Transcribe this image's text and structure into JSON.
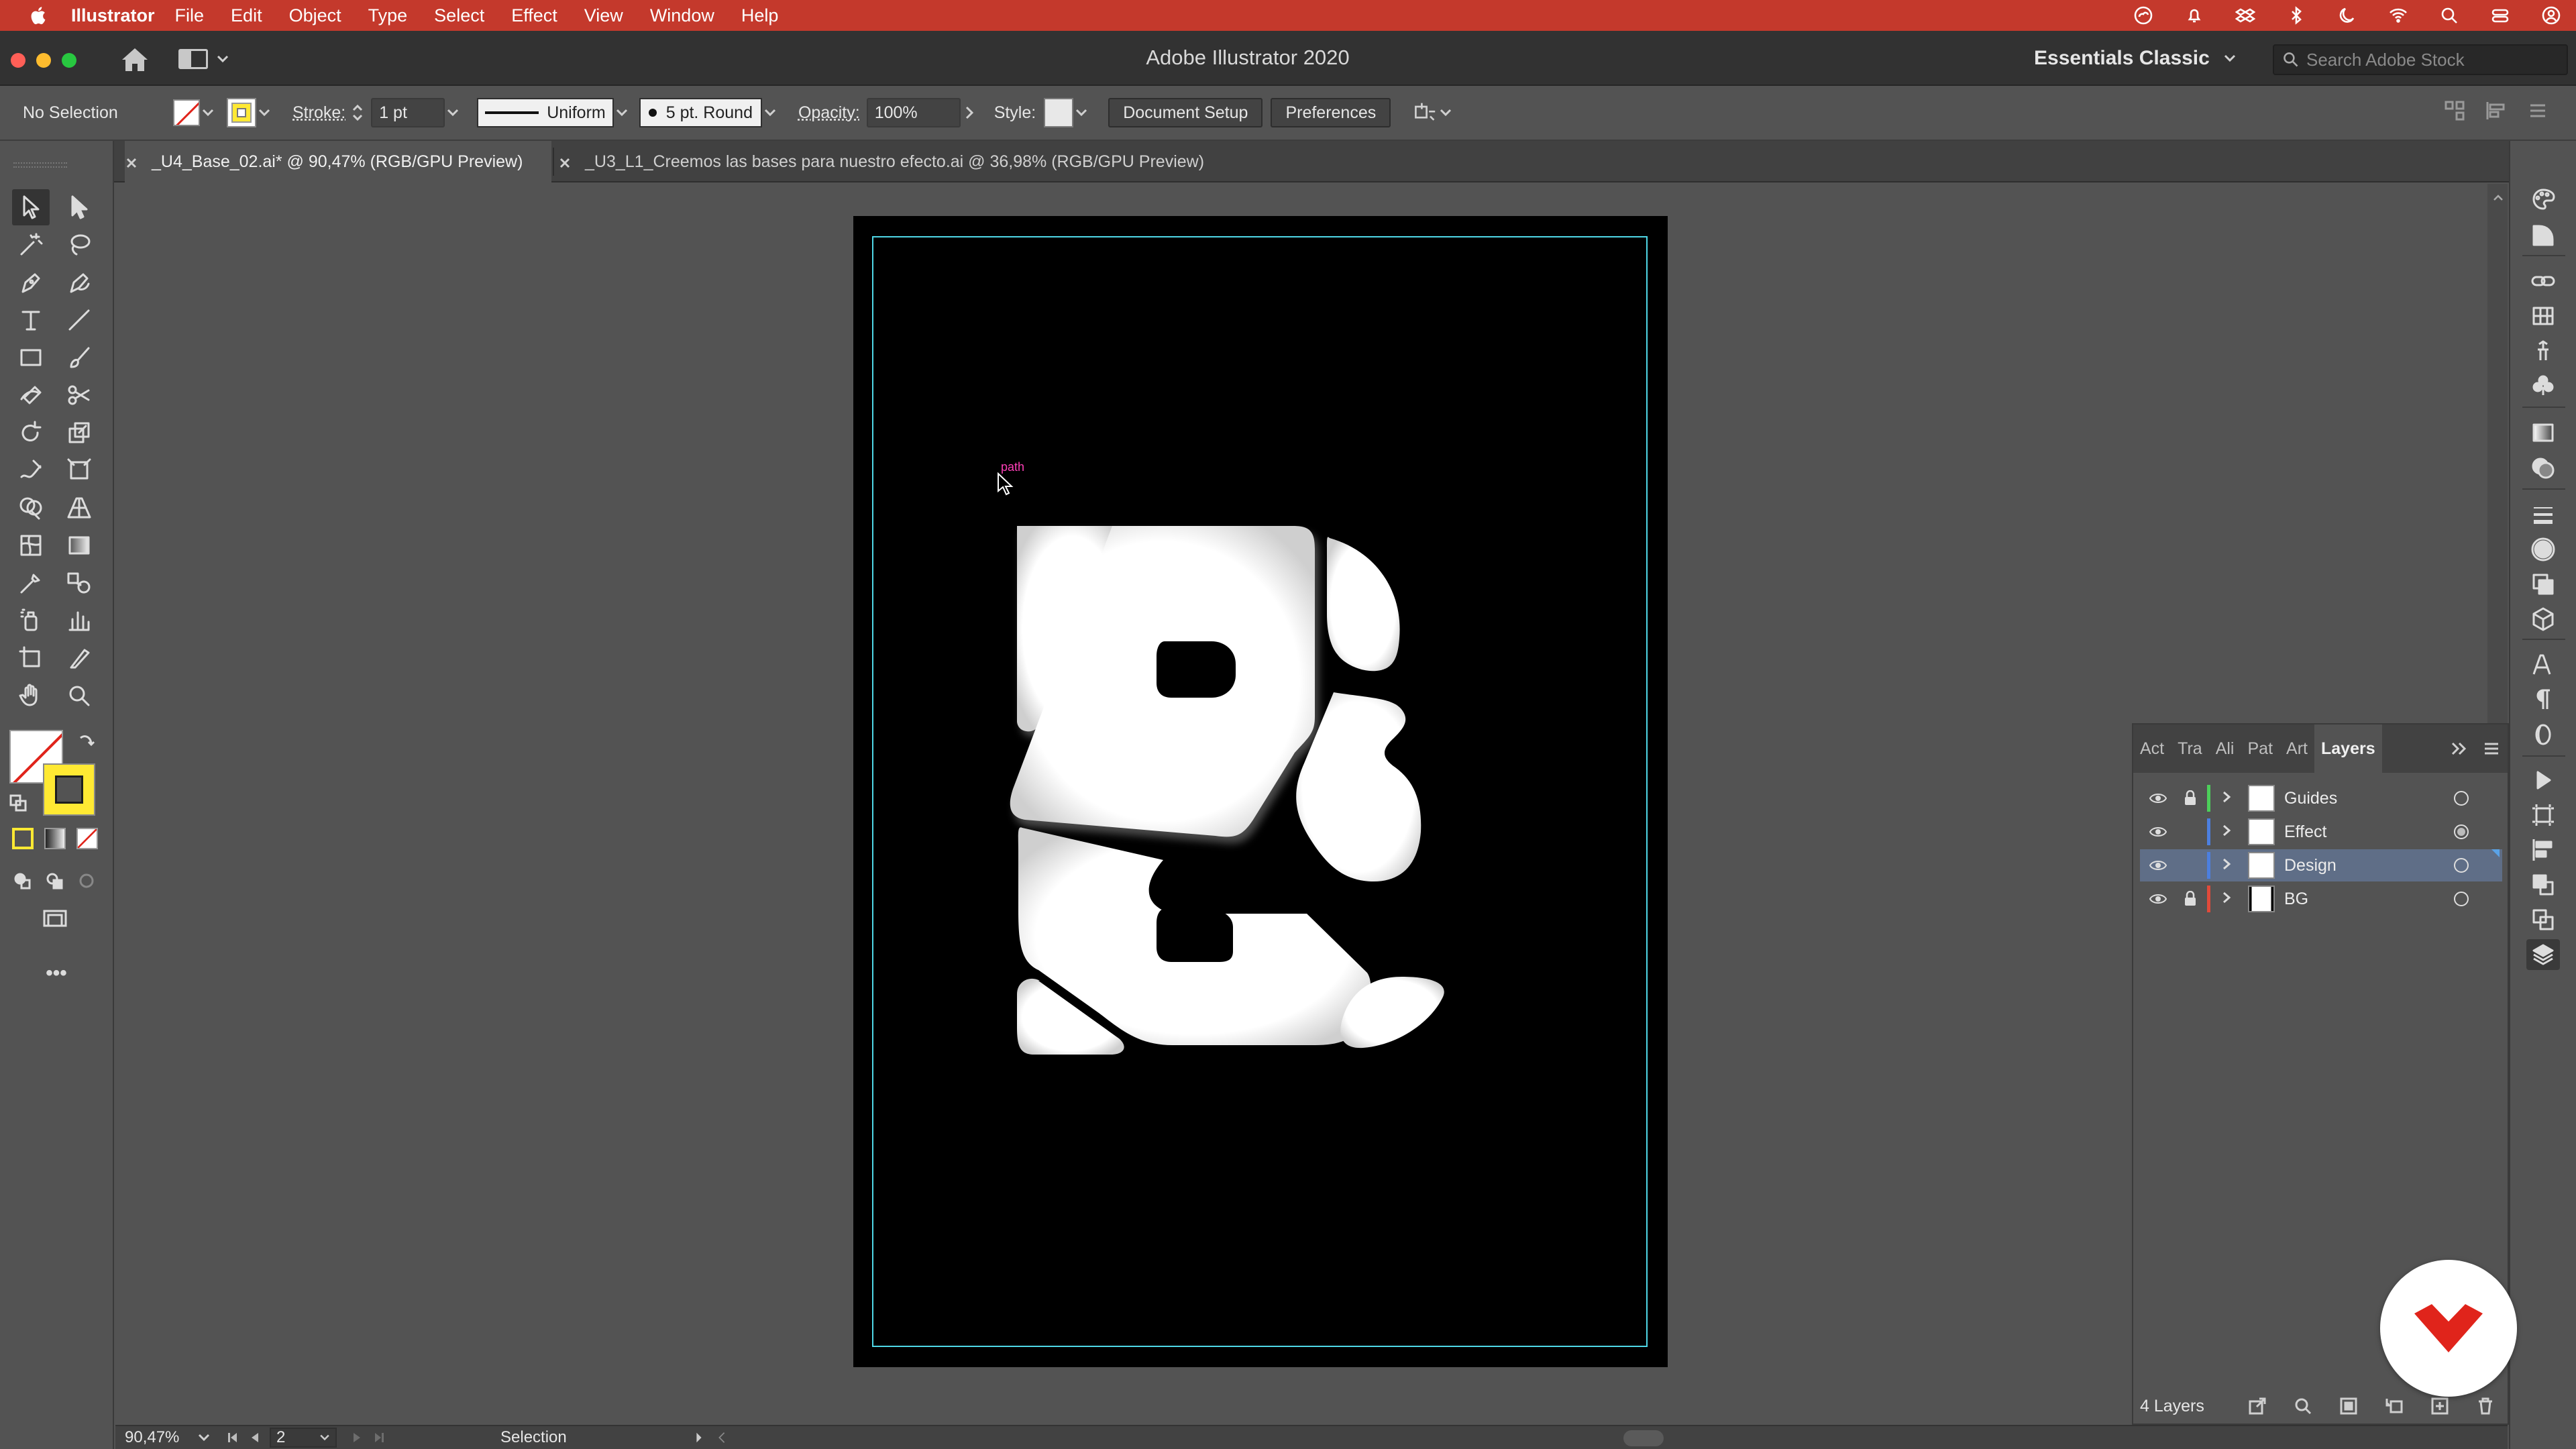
{
  "menubar": {
    "app_name": "Illustrator",
    "items": [
      "File",
      "Edit",
      "Object",
      "Type",
      "Select",
      "Effect",
      "View",
      "Window",
      "Help"
    ],
    "status_icons": [
      "creative-cloud-icon",
      "notification-icon",
      "dropbox-icon",
      "bluetooth-icon",
      "moon-icon",
      "wifi-icon",
      "search-icon",
      "control-center-icon",
      "user-icon"
    ],
    "color": "#c4392c"
  },
  "titlebar": {
    "title": "Adobe Illustrator 2020",
    "workspace": "Essentials Classic",
    "search_placeholder": "Search Adobe Stock"
  },
  "controlbar": {
    "selection_label": "No Selection",
    "stroke_label": "Stroke:",
    "stroke_weight": "1 pt",
    "variable_width_profile": "Uniform",
    "brush": "5 pt. Round",
    "opacity_label": "Opacity:",
    "opacity_value": "100%",
    "style_label": "Style:",
    "document_setup": "Document Setup",
    "preferences": "Preferences",
    "fill_color": "none",
    "stroke_color": "#ffe933"
  },
  "tabs": [
    {
      "label": "_U4_Base_02.ai* @ 90,47% (RGB/GPU Preview)",
      "active": true
    },
    {
      "label": "_U3_L1_Creemos las bases para nuestro efecto.ai @ 36,98% (RGB/GPU Preview)",
      "active": false
    }
  ],
  "canvas": {
    "smart_guide_label": "path",
    "artboard_color": "#000000",
    "guide_color": "#4fd7e6"
  },
  "statusbar": {
    "zoom": "90,47%",
    "artboard_number": "2",
    "mode": "Selection"
  },
  "layers_panel": {
    "tabs": [
      "Act",
      "Tra",
      "Ali",
      "Pat",
      "Art",
      "Layers"
    ],
    "active_tab": "Layers",
    "layers": [
      {
        "name": "Guides",
        "color": "#4ccf5a",
        "locked": true,
        "visible": true
      },
      {
        "name": "Effect",
        "color": "#4c7fdf",
        "locked": false,
        "visible": true
      },
      {
        "name": "Design",
        "color": "#4c7fdf",
        "locked": false,
        "visible": true,
        "selected": true
      },
      {
        "name": "BG",
        "color": "#e04a3a",
        "locked": true,
        "visible": true
      }
    ],
    "count": "4 Layers"
  },
  "icons": {
    "tools": [
      "selection-tool-icon",
      "direct-selection-tool-icon",
      "magic-wand-icon",
      "lasso-icon",
      "pen-tool-icon",
      "curvature-tool-icon",
      "type-tool-icon",
      "line-tool-icon",
      "rectangle-tool-icon",
      "paintbrush-icon",
      "shaper-tool-icon",
      "scissors-icon",
      "rotate-tool-icon",
      "scale-tool-icon",
      "warp-tool-icon",
      "free-transform-icon",
      "shape-builder-icon",
      "perspective-grid-icon",
      "mesh-tool-icon",
      "gradient-tool-icon",
      "eyedropper-icon",
      "blend-tool-icon",
      "symbol-sprayer-icon",
      "graph-tool-icon",
      "artboard-tool-icon",
      "slice-tool-icon",
      "hand-tool-icon",
      "zoom-tool-icon"
    ]
  }
}
